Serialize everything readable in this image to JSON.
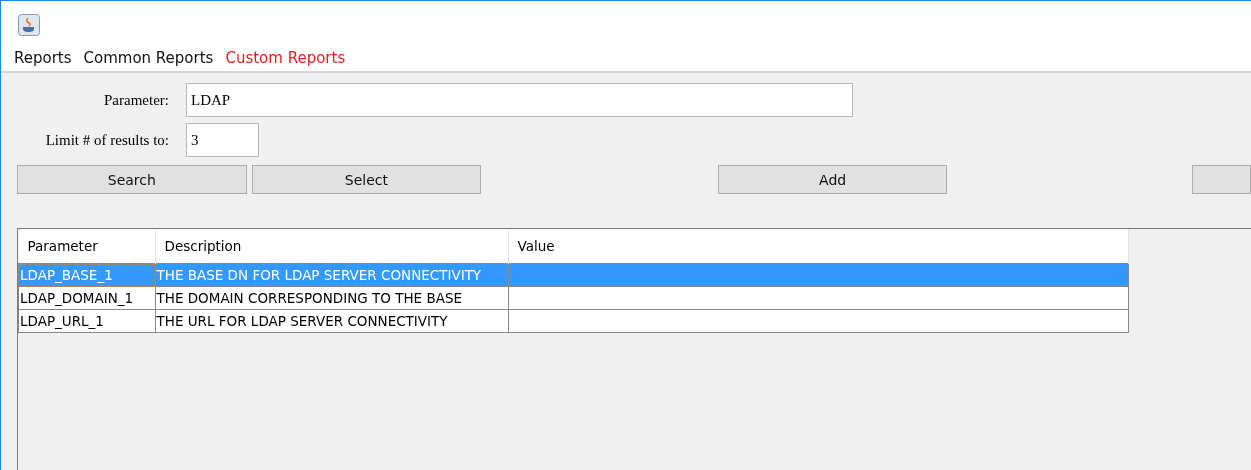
{
  "menu": [
    {
      "label": "Reports",
      "selected": false
    },
    {
      "label": "Common Reports",
      "selected": false
    },
    {
      "label": "Custom Reports",
      "selected": true
    }
  ],
  "form": {
    "parameter_label": "Parameter:",
    "parameter_value": "LDAP",
    "limit_label": "Limit # of results to:",
    "limit_value": "3"
  },
  "buttons": [
    {
      "kind": "labeled",
      "label": "Search"
    },
    {
      "kind": "labeled",
      "label": "Select"
    },
    {
      "kind": "gap"
    },
    {
      "kind": "labeled",
      "label": "Add"
    },
    {
      "kind": "gap"
    },
    {
      "kind": "blank"
    }
  ],
  "table": {
    "columns": [
      "Parameter",
      "Description",
      "Value"
    ],
    "rows": [
      {
        "cells": [
          "LDAP_BASE_1",
          "THE BASE DN FOR LDAP SERVER CONNECTIVITY"
        ],
        "selected": true
      },
      {
        "cells": [
          "LDAP_DOMAIN_1",
          "THE DOMAIN CORRESPONDING TO THE BASE"
        ],
        "selected": false
      },
      {
        "cells": [
          "LDAP_URL_1",
          "THE URL FOR LDAP SERVER CONNECTIVITY"
        ],
        "selected": false
      }
    ]
  }
}
